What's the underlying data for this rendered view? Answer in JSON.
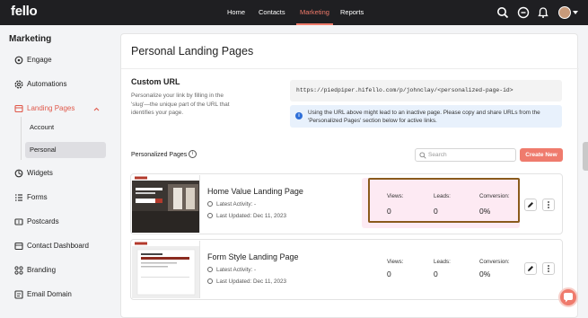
{
  "app": {
    "logo": "fello"
  },
  "topnav": {
    "items": [
      {
        "label": "Home",
        "active": false
      },
      {
        "label": "Contacts",
        "active": false
      },
      {
        "label": "Marketing",
        "active": true
      },
      {
        "label": "Reports",
        "active": false
      }
    ],
    "icons": [
      "search-icon",
      "add-circle-icon",
      "bell-icon",
      "user-avatar",
      "chevron-down-icon"
    ]
  },
  "sidebar": {
    "title": "Marketing",
    "items": [
      {
        "label": "Engage",
        "icon": "gear-icon"
      },
      {
        "label": "Automations",
        "icon": "cog-icon"
      },
      {
        "label": "Landing Pages",
        "icon": "landing-page-icon",
        "expanded": true
      },
      {
        "label": "Widgets",
        "icon": "widget-icon"
      },
      {
        "label": "Forms",
        "icon": "form-icon"
      },
      {
        "label": "Postcards",
        "icon": "postcard-icon"
      },
      {
        "label": "Contact Dashboard",
        "icon": "dashboard-icon"
      },
      {
        "label": "Branding",
        "icon": "branding-icon"
      },
      {
        "label": "Email Domain",
        "icon": "email-domain-icon"
      }
    ],
    "subitems": [
      {
        "label": "Account",
        "selected": false
      },
      {
        "label": "Personal",
        "selected": true
      }
    ]
  },
  "main": {
    "title": "Personal Landing Pages",
    "custom_url": {
      "title": "Custom URL",
      "description": "Personalize your link by filling in the 'slug'—the unique part of the URL that identifies your page.",
      "url": "https://piedpiper.hifello.com/p/johnclay/<personalized-page-id>",
      "info": "Using the URL above might lead to an inactive page. Please copy and share URLs from the 'Personalized Pages' section below for active links."
    },
    "personalized_pages": {
      "label": "Personalized Pages",
      "search_placeholder": "Search",
      "create_button": "Create New",
      "stats_labels": {
        "views": "Views:",
        "leads": "Leads:",
        "conversion": "Conversion:"
      },
      "rows": [
        {
          "title": "Home Value Landing Page",
          "latest_activity": "Latest Activity: -",
          "last_updated": "Last Updated: Dec 11, 2023",
          "views": "0",
          "leads": "0",
          "conversion": "0%",
          "highlighted": true
        },
        {
          "title": "Form Style Landing Page",
          "latest_activity": "Latest Activity: -",
          "last_updated": "Last Updated: Dec 11, 2023",
          "views": "0",
          "leads": "0",
          "conversion": "0%",
          "highlighted": false
        }
      ]
    }
  },
  "colors": {
    "accent": "#ef7b6d",
    "nav_bg": "#1f1f22",
    "highlight_border": "#8a5a1c"
  }
}
